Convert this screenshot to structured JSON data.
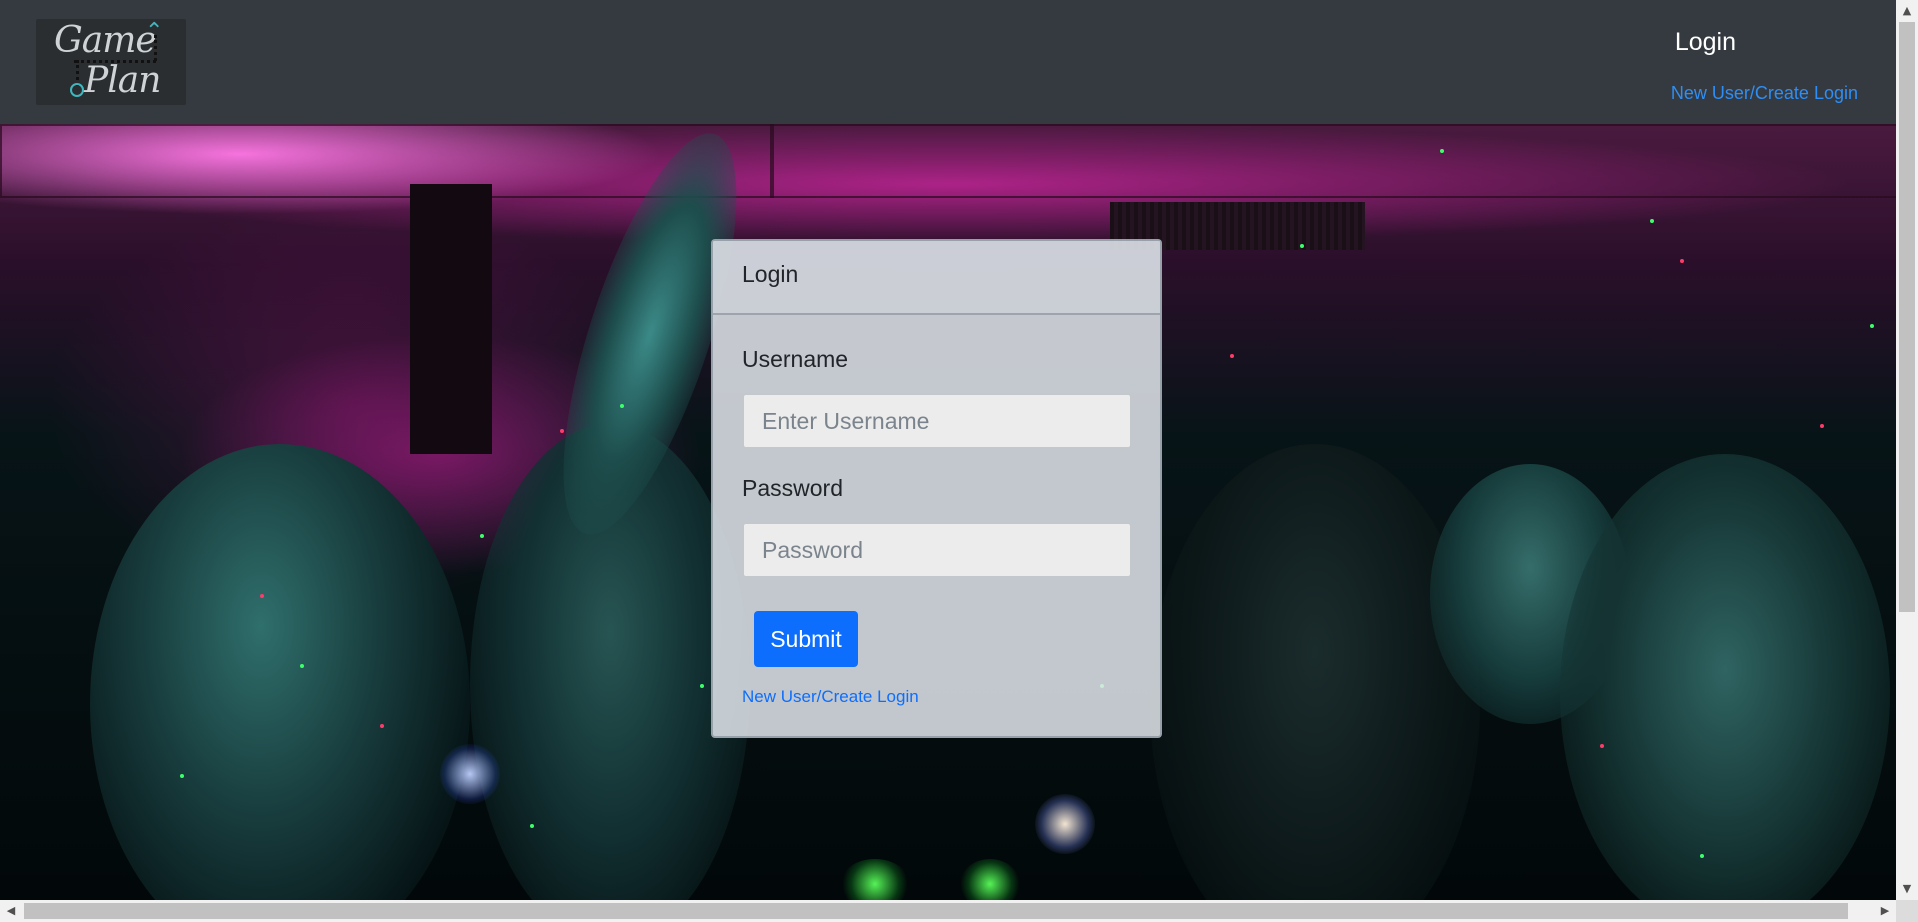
{
  "navbar": {
    "logo_label": "Game Plan",
    "logo_word1": "Game",
    "logo_word2": "Plan",
    "login_link": "Login",
    "new_user_link": "New User/Create Login"
  },
  "login_card": {
    "title": "Login",
    "username_label": "Username",
    "username_placeholder": "Enter Username",
    "username_value": "",
    "password_label": "Password",
    "password_placeholder": "Password",
    "password_value": "",
    "submit_label": "Submit",
    "new_user_link": "New User/Create Login"
  },
  "background": {
    "description_icon": "party-crowd-photo"
  },
  "colors": {
    "navbar_bg": "#343a40",
    "primary": "#0d6efd",
    "link": "#2f8ef5",
    "logo_accent": "#3fb7bf"
  }
}
